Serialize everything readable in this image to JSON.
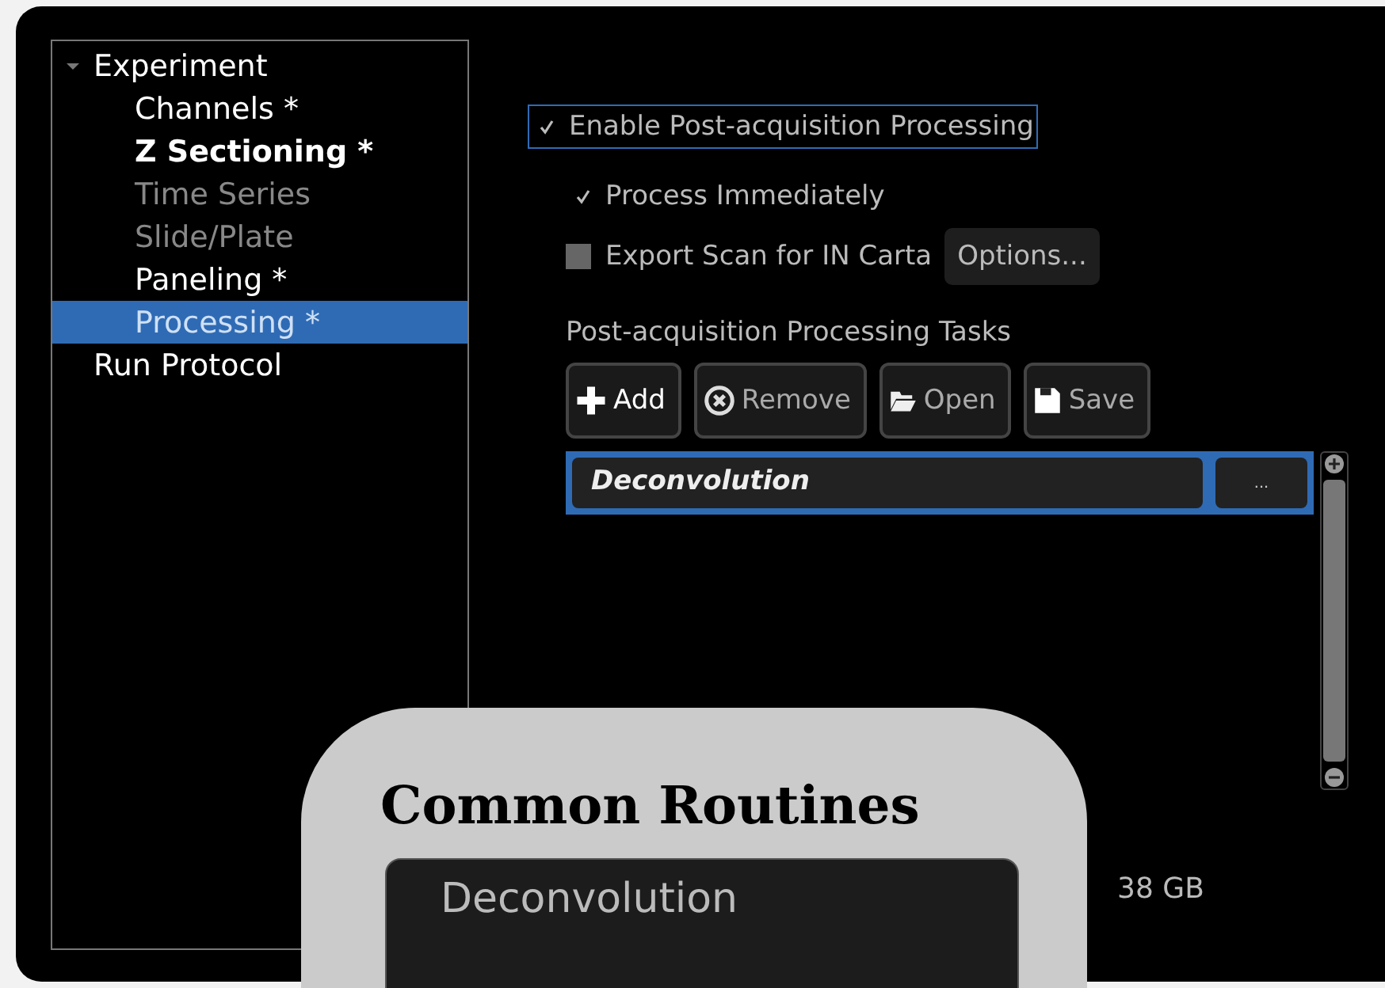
{
  "tree": [
    {
      "label": "Experiment",
      "expanded": true,
      "selected": false,
      "disabled": false,
      "bold": false,
      "children": [
        {
          "label": "Channels *",
          "selected": false,
          "disabled": false,
          "bold": false
        },
        {
          "label": "Z Sectioning *",
          "selected": false,
          "disabled": false,
          "bold": true
        },
        {
          "label": "Time Series",
          "selected": false,
          "disabled": true,
          "bold": false
        },
        {
          "label": "Slide/Plate",
          "selected": false,
          "disabled": true,
          "bold": false
        },
        {
          "label": "Paneling *",
          "selected": false,
          "disabled": false,
          "bold": false
        },
        {
          "label": "Processing *",
          "selected": true,
          "disabled": false,
          "bold": false
        }
      ]
    },
    {
      "label": "Run Protocol",
      "selected": false,
      "disabled": false,
      "bold": false
    }
  ],
  "enable_processing": {
    "label": "Enable Post-acquisition Processing",
    "checked": true,
    "focused": true
  },
  "process_immediately": {
    "label": "Process Immediately",
    "checked": true
  },
  "export_scan": {
    "label": "Export Scan for IN Carta",
    "checked": false,
    "button": "Options..."
  },
  "tasks": {
    "heading": "Post-acquisition Processing Tasks",
    "buttons": [
      {
        "kind": "add",
        "label": "Add"
      },
      {
        "kind": "remove",
        "label": "Remove"
      },
      {
        "kind": "open",
        "label": "Open"
      },
      {
        "kind": "save",
        "label": "Save"
      }
    ],
    "items": [
      {
        "name": "Deconvolution",
        "button": "...",
        "selected": true
      }
    ]
  },
  "storage": "38 GB",
  "callout": {
    "title": "Common Routines",
    "menu_items": [
      "Deconvolution"
    ]
  }
}
